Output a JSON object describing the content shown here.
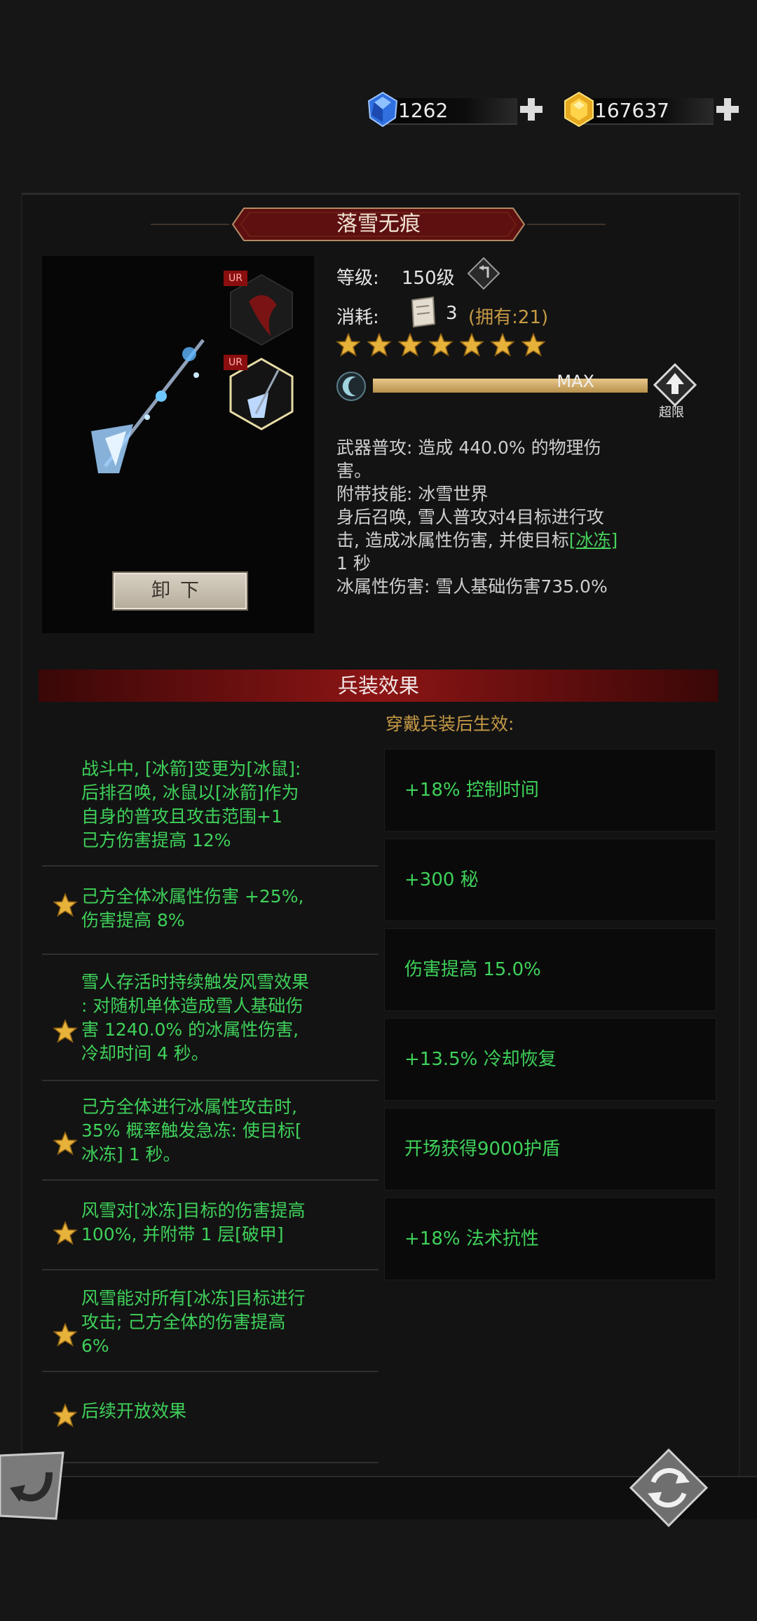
{
  "currency": {
    "gems": "1262",
    "gold": "167637"
  },
  "item": {
    "title": "落雪无痕",
    "level_label": "等级:",
    "level_value": "150级",
    "cost_label": "消耗:",
    "cost_value": "3",
    "owned": "(拥有:21)",
    "stars": 7,
    "progress_label": "MAX",
    "progress_fraction": 1.0,
    "breakthrough_label": "超限",
    "slot_badge_1": "UR",
    "slot_badge_2": "UR",
    "unequip_label": "卸下",
    "desc_lines": [
      "武器普攻: 造成 440.0% 的物理伤",
      "害。",
      "附带技能: 冰雪世界",
      "身后召唤, 雪人普攻对4目标进行攻",
      "击, 造成冰属性伤害, 并使目标",
      "1 秒",
      "冰属性伤害: 雪人基础伤害735.0%"
    ],
    "desc_link": "[冰冻]"
  },
  "section": {
    "title": "兵装效果",
    "subtitle": "穿戴兵装后生效:"
  },
  "effects": [
    {
      "lines": [
        "战斗中, [冰箭]变更为[冰鼠]:",
        "后排召唤, 冰鼠以[冰箭]作为",
        "自身的普攻且攻击范围+1",
        "己方伤害提高 12%"
      ],
      "star": false
    },
    {
      "lines": [
        "己方全体冰属性伤害 +25%,",
        "伤害提高 8%"
      ],
      "star": true
    },
    {
      "lines": [
        "雪人存活时持续触发风雪效果",
        ": 对随机单体造成雪人基础伤",
        "害 1240.0% 的冰属性伤害,",
        "冷却时间 4 秒。"
      ],
      "star": true
    },
    {
      "lines": [
        "己方全体进行冰属性攻击时,",
        "35% 概率触发急冻: 使目标[",
        "冰冻] 1 秒。"
      ],
      "star": true
    },
    {
      "lines": [
        "风雪对[冰冻]目标的伤害提高",
        "100%, 并附带 1 层[破甲]"
      ],
      "star": true
    },
    {
      "lines": [
        "风雪能对所有[冰冻]目标进行",
        "攻击; 己方全体的伤害提高",
        "6%"
      ],
      "star": true
    },
    {
      "lines": [
        "后续开放效果"
      ],
      "star": true
    }
  ],
  "bonuses": [
    "+18% 控制时间",
    "+300 秘",
    "伤害提高 15.0%",
    "+13.5% 冷却恢复",
    "开场获得9000护盾",
    "+18% 法术抗性"
  ],
  "colors": {
    "green": "#3fd15a",
    "gold": "#c69a46",
    "header_red": "#8c1515"
  }
}
